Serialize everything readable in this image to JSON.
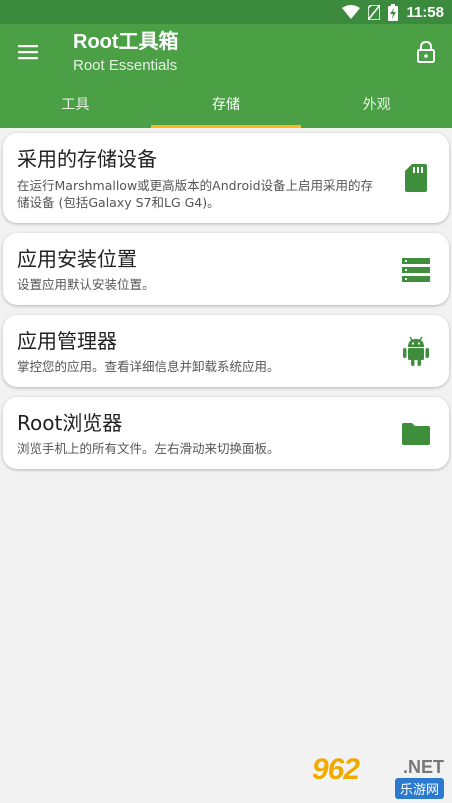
{
  "status_bar": {
    "time": "11:58",
    "icons": [
      "wifi-icon",
      "no-sim-icon",
      "battery-charging-icon"
    ]
  },
  "appbar": {
    "title": "Root工具箱",
    "subtitle": "Root Essentials",
    "menu_icon": "menu-icon",
    "lock_icon": "lock-icon"
  },
  "tabs": [
    {
      "label": "工具",
      "active": false
    },
    {
      "label": "存储",
      "active": true
    },
    {
      "label": "外观",
      "active": false
    }
  ],
  "cards": [
    {
      "title": "采用的存储设备",
      "description": "在运行Marshmallow或更高版本的Android设备上启用采用的存储设备 (包括Galaxy S7和LG G4)。",
      "icon": "sd-card-icon"
    },
    {
      "title": "应用安装位置",
      "description": "设置应用默认安装位置。",
      "icon": "storage-list-icon"
    },
    {
      "title": "应用管理器",
      "description": "掌控您的应用。查看详细信息并卸载系统应用。",
      "icon": "android-icon"
    },
    {
      "title": "Root浏览器",
      "description": "浏览手机上的所有文件。左右滑动来切换面板。",
      "icon": "folder-icon"
    }
  ],
  "colors": {
    "statusbar": "#3b8a3e",
    "appbar": "#4ba046",
    "tab_indicator": "#ffb81c",
    "icon_green": "#3e8e3b"
  },
  "watermark": {
    "logo": "962",
    "net": ".NET",
    "sub": "乐游网"
  }
}
